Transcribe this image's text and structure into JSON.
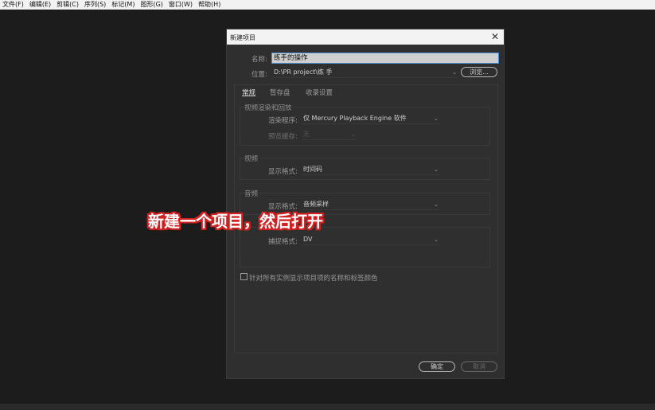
{
  "menubar": {
    "items": [
      "文件(F)",
      "编辑(E)",
      "剪辑(C)",
      "序列(S)",
      "标记(M)",
      "图形(G)",
      "窗口(W)",
      "帮助(H)"
    ]
  },
  "dialog": {
    "title": "新建项目",
    "close": "✕",
    "name_label": "名称:",
    "name_value": "练手的操作",
    "location_label": "位置:",
    "location_value": "D:\\PR project\\练 手",
    "browse_label": "浏览...",
    "tabs": [
      "常规",
      "暂存盘",
      "收录设置"
    ],
    "video_rendering": {
      "title": "视频渲染和回放",
      "renderer_label": "渲染程序:",
      "renderer_value": "仅 Mercury Playback Engine 软件",
      "preview_cache_label": "预览缓存:",
      "preview_cache_value": "无"
    },
    "video": {
      "title": "视频",
      "display_format_label": "显示格式:",
      "display_format_value": "时间码"
    },
    "audio": {
      "title": "音频",
      "display_format_label": "显示格式:",
      "display_format_value": "音频采样"
    },
    "capture": {
      "format_label": "捕捉格式:",
      "format_value": "DV"
    },
    "checkbox_label": "针对所有实例显示项目项的名称和标签颜色",
    "ok_label": "确定",
    "cancel_label": "取消"
  },
  "overlay": {
    "caption": "新建一个项目，然后打开"
  },
  "icons": {
    "dropdown": "chevron-down-icon",
    "close": "close-icon"
  },
  "colors": {
    "focus_border": "#4d8fd6",
    "overlay_outline": "#d42020"
  }
}
